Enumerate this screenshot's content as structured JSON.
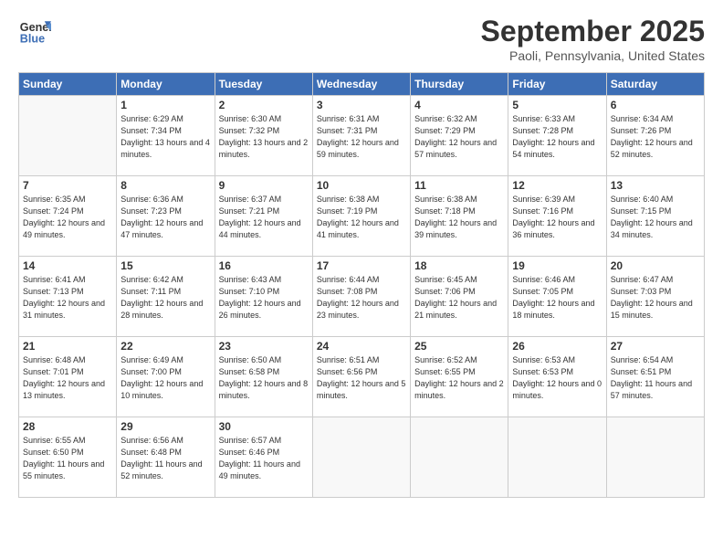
{
  "header": {
    "logo_line1": "General",
    "logo_line2": "Blue",
    "month_title": "September 2025",
    "location": "Paoli, Pennsylvania, United States"
  },
  "weekdays": [
    "Sunday",
    "Monday",
    "Tuesday",
    "Wednesday",
    "Thursday",
    "Friday",
    "Saturday"
  ],
  "weeks": [
    [
      {
        "day": "",
        "sunrise": "",
        "sunset": "",
        "daylight": ""
      },
      {
        "day": "1",
        "sunrise": "Sunrise: 6:29 AM",
        "sunset": "Sunset: 7:34 PM",
        "daylight": "Daylight: 13 hours and 4 minutes."
      },
      {
        "day": "2",
        "sunrise": "Sunrise: 6:30 AM",
        "sunset": "Sunset: 7:32 PM",
        "daylight": "Daylight: 13 hours and 2 minutes."
      },
      {
        "day": "3",
        "sunrise": "Sunrise: 6:31 AM",
        "sunset": "Sunset: 7:31 PM",
        "daylight": "Daylight: 12 hours and 59 minutes."
      },
      {
        "day": "4",
        "sunrise": "Sunrise: 6:32 AM",
        "sunset": "Sunset: 7:29 PM",
        "daylight": "Daylight: 12 hours and 57 minutes."
      },
      {
        "day": "5",
        "sunrise": "Sunrise: 6:33 AM",
        "sunset": "Sunset: 7:28 PM",
        "daylight": "Daylight: 12 hours and 54 minutes."
      },
      {
        "day": "6",
        "sunrise": "Sunrise: 6:34 AM",
        "sunset": "Sunset: 7:26 PM",
        "daylight": "Daylight: 12 hours and 52 minutes."
      }
    ],
    [
      {
        "day": "7",
        "sunrise": "Sunrise: 6:35 AM",
        "sunset": "Sunset: 7:24 PM",
        "daylight": "Daylight: 12 hours and 49 minutes."
      },
      {
        "day": "8",
        "sunrise": "Sunrise: 6:36 AM",
        "sunset": "Sunset: 7:23 PM",
        "daylight": "Daylight: 12 hours and 47 minutes."
      },
      {
        "day": "9",
        "sunrise": "Sunrise: 6:37 AM",
        "sunset": "Sunset: 7:21 PM",
        "daylight": "Daylight: 12 hours and 44 minutes."
      },
      {
        "day": "10",
        "sunrise": "Sunrise: 6:38 AM",
        "sunset": "Sunset: 7:19 PM",
        "daylight": "Daylight: 12 hours and 41 minutes."
      },
      {
        "day": "11",
        "sunrise": "Sunrise: 6:38 AM",
        "sunset": "Sunset: 7:18 PM",
        "daylight": "Daylight: 12 hours and 39 minutes."
      },
      {
        "day": "12",
        "sunrise": "Sunrise: 6:39 AM",
        "sunset": "Sunset: 7:16 PM",
        "daylight": "Daylight: 12 hours and 36 minutes."
      },
      {
        "day": "13",
        "sunrise": "Sunrise: 6:40 AM",
        "sunset": "Sunset: 7:15 PM",
        "daylight": "Daylight: 12 hours and 34 minutes."
      }
    ],
    [
      {
        "day": "14",
        "sunrise": "Sunrise: 6:41 AM",
        "sunset": "Sunset: 7:13 PM",
        "daylight": "Daylight: 12 hours and 31 minutes."
      },
      {
        "day": "15",
        "sunrise": "Sunrise: 6:42 AM",
        "sunset": "Sunset: 7:11 PM",
        "daylight": "Daylight: 12 hours and 28 minutes."
      },
      {
        "day": "16",
        "sunrise": "Sunrise: 6:43 AM",
        "sunset": "Sunset: 7:10 PM",
        "daylight": "Daylight: 12 hours and 26 minutes."
      },
      {
        "day": "17",
        "sunrise": "Sunrise: 6:44 AM",
        "sunset": "Sunset: 7:08 PM",
        "daylight": "Daylight: 12 hours and 23 minutes."
      },
      {
        "day": "18",
        "sunrise": "Sunrise: 6:45 AM",
        "sunset": "Sunset: 7:06 PM",
        "daylight": "Daylight: 12 hours and 21 minutes."
      },
      {
        "day": "19",
        "sunrise": "Sunrise: 6:46 AM",
        "sunset": "Sunset: 7:05 PM",
        "daylight": "Daylight: 12 hours and 18 minutes."
      },
      {
        "day": "20",
        "sunrise": "Sunrise: 6:47 AM",
        "sunset": "Sunset: 7:03 PM",
        "daylight": "Daylight: 12 hours and 15 minutes."
      }
    ],
    [
      {
        "day": "21",
        "sunrise": "Sunrise: 6:48 AM",
        "sunset": "Sunset: 7:01 PM",
        "daylight": "Daylight: 12 hours and 13 minutes."
      },
      {
        "day": "22",
        "sunrise": "Sunrise: 6:49 AM",
        "sunset": "Sunset: 7:00 PM",
        "daylight": "Daylight: 12 hours and 10 minutes."
      },
      {
        "day": "23",
        "sunrise": "Sunrise: 6:50 AM",
        "sunset": "Sunset: 6:58 PM",
        "daylight": "Daylight: 12 hours and 8 minutes."
      },
      {
        "day": "24",
        "sunrise": "Sunrise: 6:51 AM",
        "sunset": "Sunset: 6:56 PM",
        "daylight": "Daylight: 12 hours and 5 minutes."
      },
      {
        "day": "25",
        "sunrise": "Sunrise: 6:52 AM",
        "sunset": "Sunset: 6:55 PM",
        "daylight": "Daylight: 12 hours and 2 minutes."
      },
      {
        "day": "26",
        "sunrise": "Sunrise: 6:53 AM",
        "sunset": "Sunset: 6:53 PM",
        "daylight": "Daylight: 12 hours and 0 minutes."
      },
      {
        "day": "27",
        "sunrise": "Sunrise: 6:54 AM",
        "sunset": "Sunset: 6:51 PM",
        "daylight": "Daylight: 11 hours and 57 minutes."
      }
    ],
    [
      {
        "day": "28",
        "sunrise": "Sunrise: 6:55 AM",
        "sunset": "Sunset: 6:50 PM",
        "daylight": "Daylight: 11 hours and 55 minutes."
      },
      {
        "day": "29",
        "sunrise": "Sunrise: 6:56 AM",
        "sunset": "Sunset: 6:48 PM",
        "daylight": "Daylight: 11 hours and 52 minutes."
      },
      {
        "day": "30",
        "sunrise": "Sunrise: 6:57 AM",
        "sunset": "Sunset: 6:46 PM",
        "daylight": "Daylight: 11 hours and 49 minutes."
      },
      {
        "day": "",
        "sunrise": "",
        "sunset": "",
        "daylight": ""
      },
      {
        "day": "",
        "sunrise": "",
        "sunset": "",
        "daylight": ""
      },
      {
        "day": "",
        "sunrise": "",
        "sunset": "",
        "daylight": ""
      },
      {
        "day": "",
        "sunrise": "",
        "sunset": "",
        "daylight": ""
      }
    ]
  ]
}
